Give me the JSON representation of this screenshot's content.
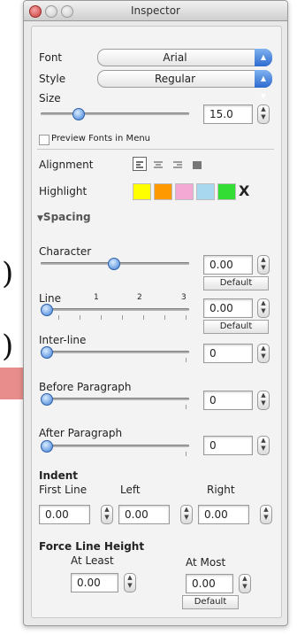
{
  "window": {
    "title": "Inspector"
  },
  "font": {
    "label": "Font",
    "value": "Arial"
  },
  "style": {
    "label": "Style",
    "value": "Regular"
  },
  "size": {
    "label": "Size",
    "value": "15.0"
  },
  "preview_fonts": {
    "label": "Preview Fonts in Menu",
    "checked": false
  },
  "alignment": {
    "label": "Alignment",
    "selected": "left"
  },
  "highlight": {
    "label": "Highlight",
    "colors": [
      "#ffff00",
      "#ff9900",
      "#f4a8d4",
      "#a8d8f0",
      "#33dd33"
    ],
    "clear_label": "X"
  },
  "spacing": {
    "header": "Spacing",
    "character": {
      "label": "Character",
      "value": "0.00",
      "default_label": "Default"
    },
    "line": {
      "label": "Line",
      "value": "0.00",
      "default_label": "Default",
      "ticks": [
        "1",
        "2",
        "3"
      ]
    },
    "inter_line": {
      "label": "Inter-line",
      "value": "0"
    },
    "before_paragraph": {
      "label": "Before Paragraph",
      "value": "0"
    },
    "after_paragraph": {
      "label": "After Paragraph",
      "value": "0"
    }
  },
  "indent": {
    "header": "Indent",
    "first_line": {
      "label": "First Line",
      "value": "0.00"
    },
    "left": {
      "label": "Left",
      "value": "0.00"
    },
    "right": {
      "label": "Right",
      "value": "0.00"
    }
  },
  "force_line_height": {
    "header": "Force Line Height",
    "at_least": {
      "label": "At Least",
      "value": "0.00"
    },
    "at_most": {
      "label": "At Most",
      "value": "0.00",
      "default_label": "Default"
    }
  },
  "annotations": {
    "paren1": ")",
    "paren2": ")"
  },
  "colors": {
    "accent": "#3d7ed6",
    "arrow": "#e88c8c"
  }
}
